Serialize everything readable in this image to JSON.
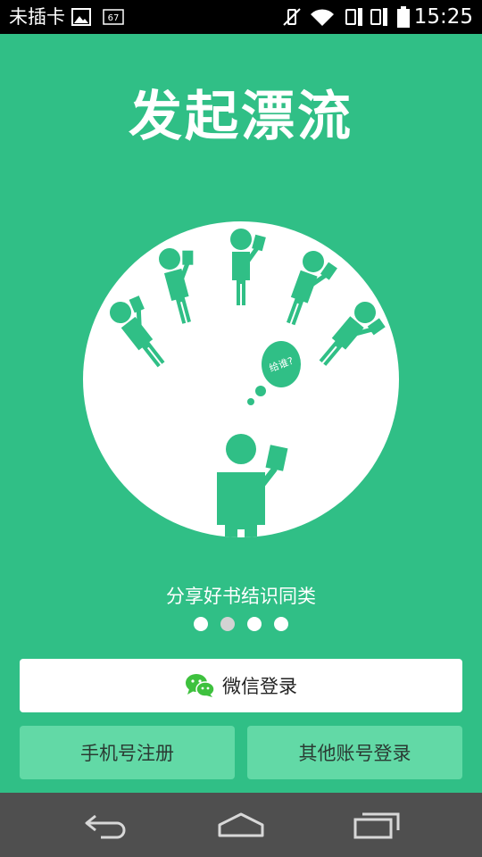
{
  "status_bar": {
    "carrier": "未插卡",
    "notification_count": "67",
    "time": "15:25"
  },
  "main": {
    "title": "发起漂流",
    "bubble_text": "给谁?",
    "subtitle": "分享好书结识同类",
    "page_indicator": {
      "count": 4,
      "active_index": 1
    },
    "wechat_login_label": "微信登录",
    "phone_register_label": "手机号注册",
    "other_account_login_label": "其他账号登录"
  },
  "colors": {
    "background": "#30bf86",
    "figure": "#30bf86",
    "secondary_button": "#62d9a6",
    "wechat_icon": "#3ec13e",
    "nav_bar": "#4f4f4f"
  }
}
